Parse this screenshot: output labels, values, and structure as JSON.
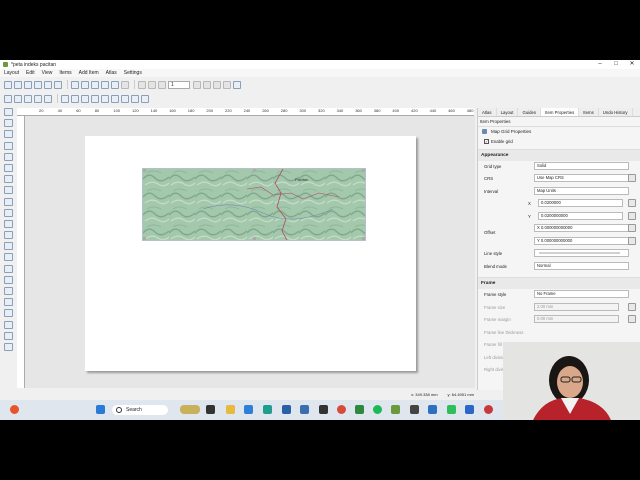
{
  "window": {
    "title": "*peta indeks pacitan"
  },
  "menu": [
    "Layout",
    "Edit",
    "View",
    "Items",
    "Add Item",
    "Atlas",
    "Settings"
  ],
  "toolbar": {
    "page_spin": "1"
  },
  "ruler_ticks": [
    "20",
    "40",
    "60",
    "80",
    "100",
    "120",
    "140",
    "160",
    "180",
    "200",
    "220",
    "240",
    "260",
    "280",
    "300",
    "320",
    "340",
    "360",
    "380",
    "400",
    "420",
    "440",
    "460",
    "480"
  ],
  "map_label": "Pacitan",
  "status": {
    "x": "x: 349.338 mm",
    "y": "y: 64.4951 mm"
  },
  "panel": {
    "tabs": [
      "Atlas",
      "Layout",
      "Guides",
      "Item Properties",
      "Items",
      "Undo History"
    ],
    "active_tab": "Item Properties",
    "title": "Item Properties",
    "subtitle": "Map Grid Properties",
    "enable_grid": "Enable grid",
    "appearance": "Appearance",
    "grid_type_label": "Grid type",
    "grid_type": "Solid",
    "crs_label": "CRS",
    "crs": "Use Map CRS",
    "interval_label": "Interval",
    "interval_units": "Map Units",
    "x_label": "X",
    "x_value": "0.0200000",
    "y_label": "Y",
    "y_value": "0.0200000000",
    "offset_label": "Offset",
    "offset_x": "X 0.000000000000",
    "offset_y": "Y 0.000000000000",
    "line_style_label": "Line style",
    "blend_label": "Blend mode",
    "blend": "Normal",
    "frame": "Frame",
    "frame_style_label": "Frame style",
    "frame_style": "No Frame",
    "frame_size_label": "Frame size",
    "frame_size": "2.00 mm",
    "frame_margin_label": "Frame margin",
    "frame_margin": "0.00 mm",
    "frame_line_label": "Frame line thickness",
    "frame_fill_label": "Frame fill colors",
    "left_div_label": "Left divisions",
    "right_div_label": "Right divisions"
  },
  "taskbar": {
    "search": "Search"
  }
}
